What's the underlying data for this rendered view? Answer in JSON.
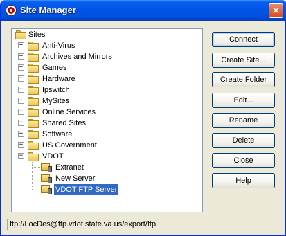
{
  "window": {
    "title": "Site Manager",
    "close_glyph": "✕"
  },
  "tree": {
    "root": "Sites",
    "items": [
      "Anti-Virus",
      "Archives and Mirrors",
      "Games",
      "Hardware",
      "Ipswitch",
      "MySites",
      "Online Services",
      "Shared Sites",
      "Software",
      "US Government",
      "VDOT"
    ],
    "vdot_children": [
      "Extranet",
      "New Server",
      "VDOT FTP Server"
    ],
    "selected": "VDOT FTP Server",
    "icons": {
      "folder": "folder-icon",
      "server": "ftp-server-icon",
      "expand": "+",
      "collapse": "−"
    }
  },
  "buttons": {
    "connect": "Connect",
    "create_site": "Create Site...",
    "create_folder": "Create Folder",
    "edit": "Edit...",
    "rename": "Rename",
    "delete": "Delete",
    "close": "Close",
    "help": "Help"
  },
  "status": {
    "text": "ftp://LocDes@ftp.vdot.state.va.us/export/ftp"
  },
  "colors": {
    "title_bar": "#0055e6",
    "selection": "#316ac5",
    "folder": "#eec65a"
  }
}
